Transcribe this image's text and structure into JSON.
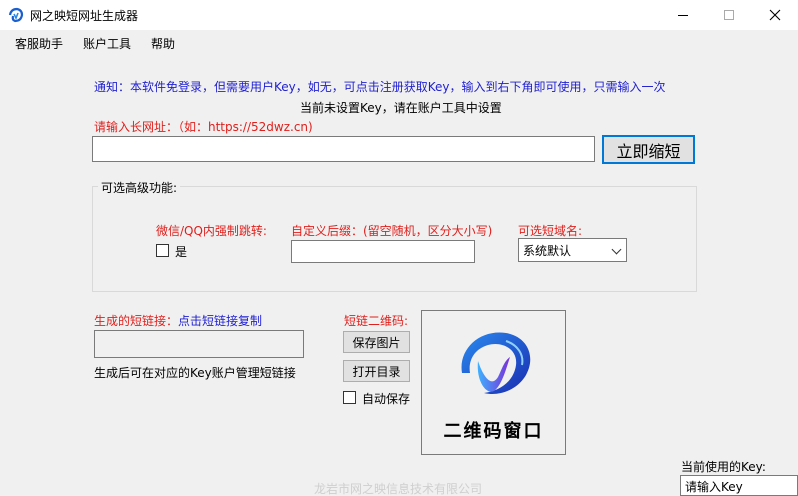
{
  "window": {
    "title": "网之映短网址生成器"
  },
  "menu": [
    "客服助手",
    "账户工具",
    "帮助"
  ],
  "notice": "通知：本软件免登录，但需要用户Key，如无，可点击注册获取Key，输入到右下角即可使用，只需输入一次",
  "key_status": "当前未设置Key，请在账户工具中设置",
  "url": {
    "label": "请输入长网址：（如：https://52dwz.cn)",
    "value": "",
    "button": "立即缩短"
  },
  "advanced": {
    "title": "可选高级功能:",
    "wechat_label": "微信/QQ内强制跳转:",
    "wechat_checkbox": "是",
    "wechat_checked": false,
    "suffix_label": "自定义后缀：(留空随机，区分大小写)",
    "suffix_value": "",
    "domain_label": "可选短域名:",
    "domain_selected": "系统默认"
  },
  "output": {
    "label_prefix": "生成的短链接：",
    "label_hint": "点击短链接复制",
    "value": "",
    "manage_note": "生成后可在对应的Key账户管理短链接"
  },
  "qr": {
    "label": "短链二维码:",
    "save_button": "保存图片",
    "open_button": "打开目录",
    "auto_save": "自动保存",
    "auto_save_checked": false,
    "caption": "二维码窗口"
  },
  "footer": "龙岩市网之映信息技术有限公司",
  "current_key": {
    "label": "当前使用的Key:",
    "value": "请输入Key"
  },
  "colors": {
    "notice": "#1f1fd0",
    "label_red": "#e0201c",
    "accent": "#0078d7"
  },
  "icons": [
    "app-logo-icon",
    "minimize-icon",
    "maximize-icon",
    "close-icon",
    "chevron-down-icon",
    "qr-logo-icon"
  ]
}
